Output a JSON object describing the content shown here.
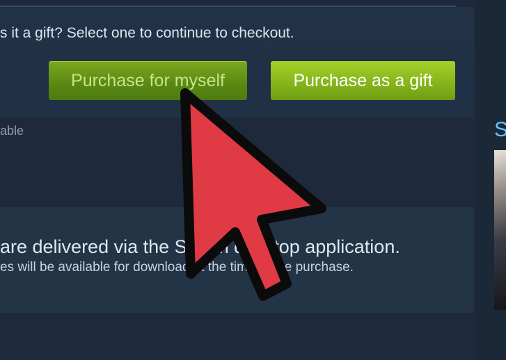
{
  "purchase": {
    "question": "s it a gift? Select one to continue to checkout.",
    "myself_label": "Purchase for myself",
    "gift_label": "Purchase as a gift",
    "side_note": "able"
  },
  "delivery": {
    "line1": "are delivered via the Steam desktop application.",
    "line2": "es will be available for download at the time of the purchase."
  },
  "sidebar": {
    "heading": "S"
  },
  "colors": {
    "background": "#1b2838",
    "button_green": "#86b51b",
    "link_blue": "#66c0f4",
    "cursor_red": "#e03a45"
  },
  "overlay": {
    "cursor_icon": "arrow-cursor-icon"
  }
}
